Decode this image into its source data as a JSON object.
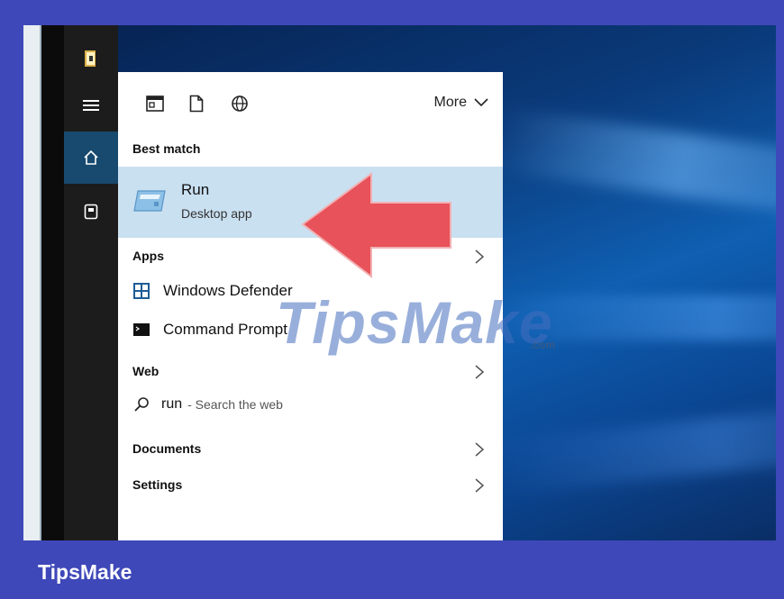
{
  "filters": {
    "icons": [
      "apps-filter-icon",
      "documents-filter-icon",
      "web-filter-icon"
    ],
    "more_label": "More"
  },
  "best_match": {
    "section": "Best match",
    "title": "Run",
    "subtitle": "Desktop app"
  },
  "apps": {
    "section": "Apps",
    "items": [
      "Windows Defender",
      "Command Prompt"
    ]
  },
  "web": {
    "section": "Web",
    "query": "run",
    "hint": "- Search the web"
  },
  "documents": {
    "section": "Documents"
  },
  "settings": {
    "section": "Settings"
  },
  "watermark": {
    "text": "TipsMake",
    "suffix": ".com"
  },
  "footer": {
    "brand": "TipsMake"
  },
  "colors": {
    "highlight": "#c9e0f1",
    "arrow": "#e8525a",
    "frame": "#3e48b9",
    "taskbar_active": "#18496e"
  }
}
